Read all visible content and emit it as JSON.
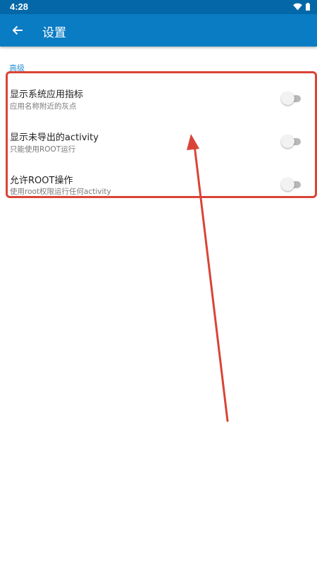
{
  "status_bar": {
    "time": "4:28",
    "icons": [
      "wifi-icon",
      "battery-icon"
    ]
  },
  "app_bar": {
    "back_icon": "arrow-back-icon",
    "title": "设置"
  },
  "category": {
    "title": "高级"
  },
  "preferences": [
    {
      "title": "显示系统应用指标",
      "summary": "应用名称附近的灰点",
      "enabled": false
    },
    {
      "title": "显示未导出的activity",
      "summary": "只能使用ROOT运行",
      "enabled": false
    },
    {
      "title": "允许ROOT操作",
      "summary": "使用root权限运行任何activity",
      "enabled": false
    }
  ],
  "colors": {
    "status_bar": "#0468a8",
    "app_bar": "#0a7cc4",
    "accent": "#2b8fd6",
    "annotation": "#d94436"
  }
}
